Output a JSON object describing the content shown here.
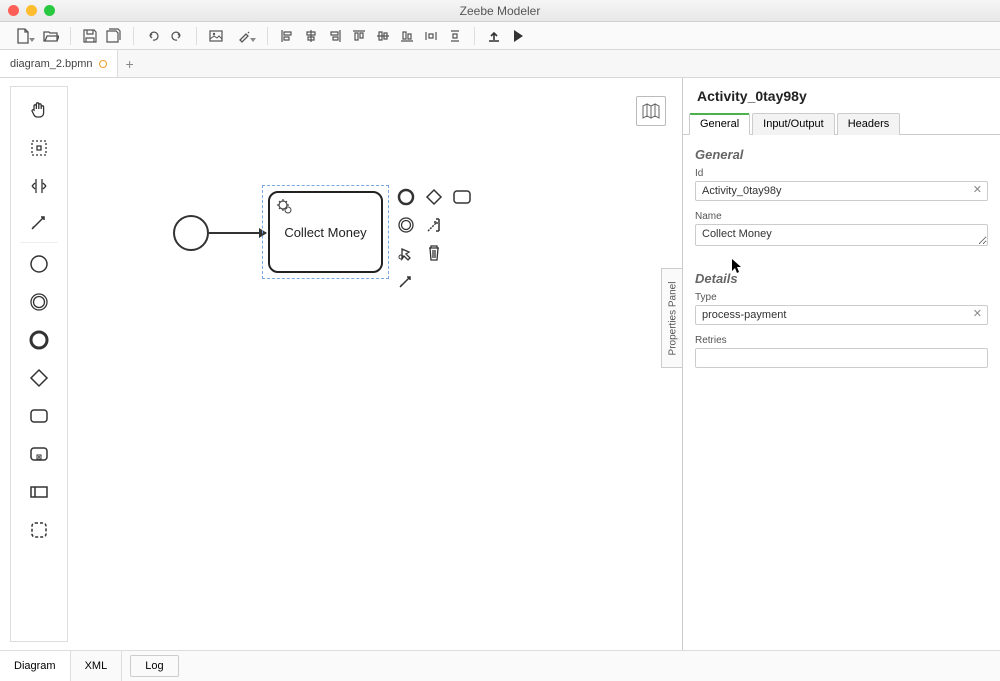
{
  "window": {
    "title": "Zeebe Modeler"
  },
  "file_tab": {
    "name": "diagram_2.bpmn"
  },
  "canvas": {
    "task_label": "Collect Money"
  },
  "properties": {
    "element_name": "Activity_0tay98y",
    "tabs": [
      "General",
      "Input/Output",
      "Headers"
    ],
    "active_tab": 0,
    "general": {
      "section": "General",
      "id_label": "Id",
      "id_value": "Activity_0tay98y",
      "name_label": "Name",
      "name_value": "Collect Money"
    },
    "details": {
      "section": "Details",
      "type_label": "Type",
      "type_value": "process-payment",
      "retries_label": "Retries",
      "retries_value": ""
    },
    "toggle_label": "Properties Panel"
  },
  "bottom": {
    "tabs": [
      "Diagram",
      "XML"
    ],
    "active": 0,
    "log": "Log"
  }
}
